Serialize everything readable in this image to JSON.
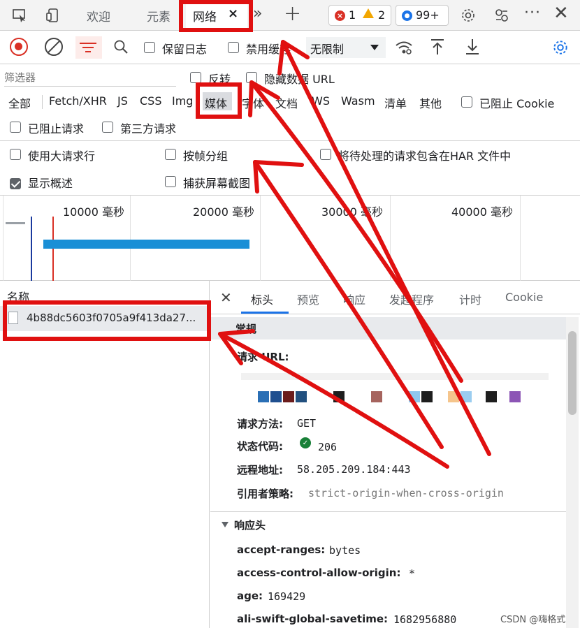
{
  "top_tabs": {
    "welcome": "欢迎",
    "elements": "元素",
    "network": "网络",
    "error_count": "1",
    "warning_count": "2",
    "issue_count": "99+"
  },
  "toolbar": {
    "preserve_log": "保留日志",
    "disable_cache": "禁用缓存",
    "throttle": "无限制"
  },
  "filter": {
    "placeholder": "筛选器",
    "invert": "反转",
    "hide_data_urls": "隐藏数据 URL",
    "types": [
      "全部",
      "Fetch/XHR",
      "JS",
      "CSS",
      "Img",
      "媒体",
      "字体",
      "文档",
      "WS",
      "Wasm",
      "清单",
      "其他"
    ],
    "blocked_cookies": "已阻止 Cookie",
    "blocked_requests": "已阻止请求",
    "third_party": "第三方请求"
  },
  "options": {
    "large_rows": "使用大请求行",
    "group_by_frame": "按帧分组",
    "har_pending": "将待处理的请求包含在HAR 文件中",
    "show_overview": "显示概述",
    "capture_screenshots": "捕获屏幕截图"
  },
  "timeline": {
    "ticks": [
      "10000 毫秒",
      "20000 毫秒",
      "30000 毫秒",
      "40000 毫秒"
    ]
  },
  "request_list": {
    "header": "名称",
    "items": [
      "4b88dc5603f0705a9f413da27..."
    ]
  },
  "detail_tabs": [
    "标头",
    "预览",
    "响应",
    "发起程序",
    "计时",
    "Cookie"
  ],
  "general": {
    "title": "常规",
    "url_label": "请求 URL:",
    "method_label": "请求方法:",
    "method_value": "GET",
    "status_label": "状态代码:",
    "status_value": "206",
    "remote_label": "远程地址:",
    "remote_value": "58.205.209.184:443",
    "referrer_label": "引用者策略:",
    "referrer_value": "strict-origin-when-cross-origin"
  },
  "response_headers": {
    "title": "响应头",
    "items": [
      {
        "key": "accept-ranges:",
        "value": "bytes"
      },
      {
        "key": "access-control-allow-origin:",
        "value": "*"
      },
      {
        "key": "age:",
        "value": "169429"
      },
      {
        "key": "ali-swift-global-savetime:",
        "value": "1682956880"
      }
    ]
  },
  "watermark": "CSDN @嗨格式",
  "colors": {
    "accent": "#1a73e8",
    "record": "#d93025",
    "annotation": "#e01010",
    "bar": "#1a8fd6"
  }
}
